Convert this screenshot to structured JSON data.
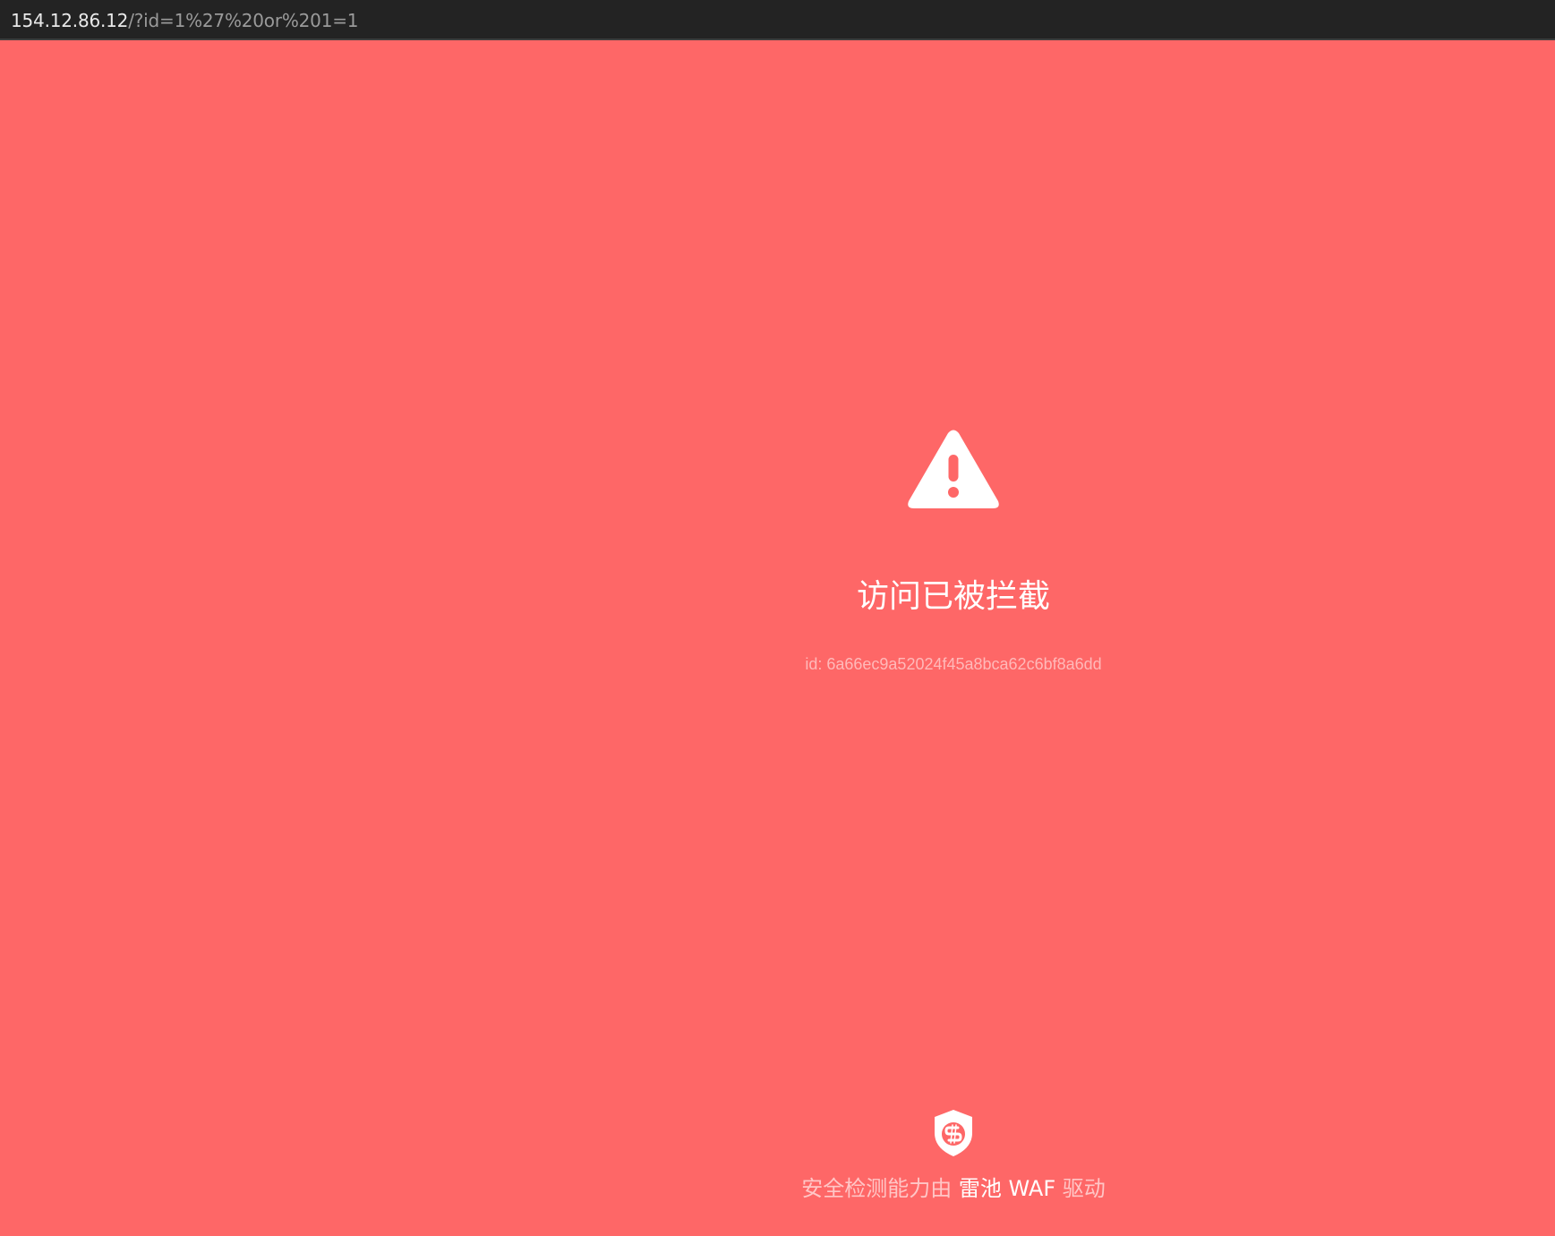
{
  "browser": {
    "url_host": "154.12.86.12",
    "url_rest": "/?id=1%27%20or%201=1"
  },
  "block_page": {
    "icon": "warning-triangle-icon",
    "title": "访问已被拦截",
    "event_id": "id: 6a66ec9a52024f45a8bca62c6bf8a6dd"
  },
  "footer": {
    "logo_icon": "safeline-shield-icon",
    "prefix": "安全检测能力由",
    "brand": "雷池 WAF",
    "suffix": "驱动"
  },
  "colors": {
    "background": "#fe6767",
    "topbar": "#232323",
    "text_primary": "#ffffff",
    "text_muted": "#ffb9b9"
  }
}
